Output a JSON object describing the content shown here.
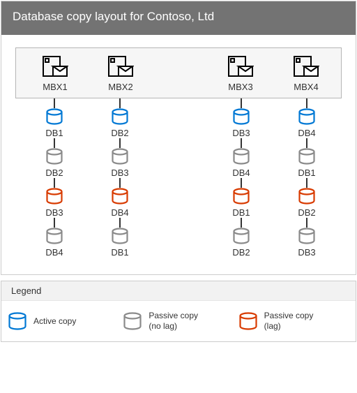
{
  "title": "Database copy layout for Contoso, Ltd",
  "colors": {
    "active": "#0078d4",
    "passive_nolag": "#8a8a8a",
    "passive_lag": "#d83b01",
    "server": "#000000"
  },
  "servers": [
    {
      "name": "MBX1"
    },
    {
      "name": "MBX2"
    },
    {
      "name": "MBX3"
    },
    {
      "name": "MBX4"
    }
  ],
  "chart_data": {
    "type": "table",
    "title": "Database copy layout",
    "columns": [
      "MBX1",
      "MBX2",
      "MBX3",
      "MBX4"
    ],
    "copy_types": [
      "active",
      "passive_nolag",
      "passive_lag",
      "passive_nolag"
    ],
    "rows": [
      {
        "copy_type": "active",
        "cells": [
          "DB1",
          "DB2",
          "DB3",
          "DB4"
        ]
      },
      {
        "copy_type": "passive_nolag",
        "cells": [
          "DB2",
          "DB3",
          "DB4",
          "DB1"
        ]
      },
      {
        "copy_type": "passive_lag",
        "cells": [
          "DB3",
          "DB4",
          "DB1",
          "DB2"
        ]
      },
      {
        "copy_type": "passive_nolag",
        "cells": [
          "DB4",
          "DB1",
          "DB2",
          "DB3"
        ]
      }
    ]
  },
  "legend": {
    "heading": "Legend",
    "items": [
      {
        "type": "active",
        "label": "Active copy"
      },
      {
        "type": "passive_nolag",
        "label": "Passive copy\n(no lag)"
      },
      {
        "type": "passive_lag",
        "label": "Passive copy\n(lag)"
      }
    ]
  }
}
